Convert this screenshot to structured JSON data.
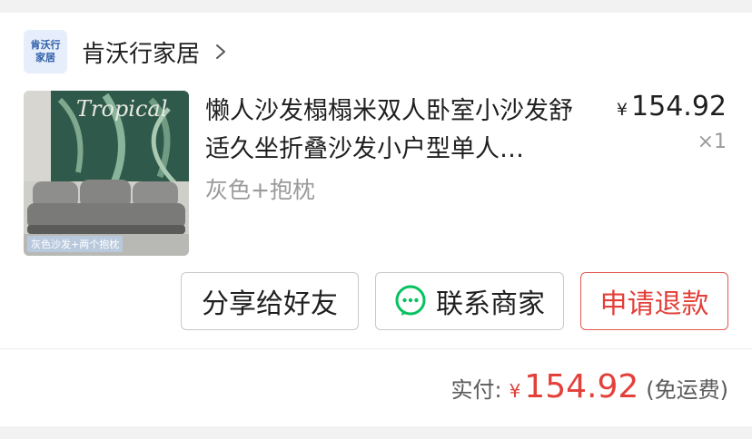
{
  "shop": {
    "logo_line1": "肯沃行",
    "logo_line2": "家居",
    "name": "肯沃行家居"
  },
  "product": {
    "image_caption": "灰色沙发+两个抱枕",
    "image_text": "Tropical",
    "title": "懒人沙发榻榻米双人卧室小沙发舒适久坐折叠沙发小户型单人…",
    "variant": "灰色+抱枕",
    "currency": "¥",
    "price": "154.92",
    "quantity": "×1"
  },
  "actions": {
    "share": "分享给好友",
    "contact": "联系商家",
    "refund": "申请退款"
  },
  "summary": {
    "label": "实付:",
    "currency": "¥",
    "amount": "154.92",
    "note": "(免运费)"
  },
  "colors": {
    "accent_red": "#e3403a",
    "wechat_green": "#07c160"
  },
  "icons": {
    "shop_chevron": "chevron-right-icon",
    "contact": "chat-bubble-icon"
  }
}
